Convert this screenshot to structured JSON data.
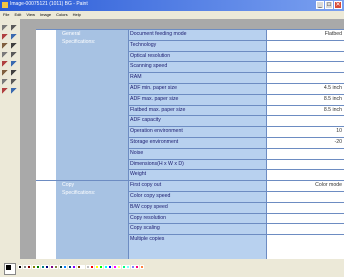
{
  "window": {
    "title": "Image-00075121 (1011) BG - Paint",
    "controls": [
      "_",
      "□",
      "✕"
    ]
  },
  "menubar": {
    "items": [
      "File",
      "Edit",
      "View",
      "Image",
      "Colors",
      "Help"
    ]
  },
  "toolbox": {
    "tools": [
      "free-select",
      "select",
      "eraser",
      "fill",
      "color-picker",
      "magnifier",
      "pencil",
      "brush",
      "airbrush",
      "text",
      "line",
      "curve",
      "rectangle",
      "polygon",
      "ellipse",
      "rounded-rectangle"
    ]
  },
  "document": {
    "sections": [
      {
        "label_lines": [
          "General",
          "Specifications:"
        ],
        "rows": [
          {
            "spec": "Document feeding mode",
            "value": "Flatbed"
          },
          {
            "spec": "Technology",
            "value": ""
          },
          {
            "spec": "Optical resolution",
            "value": ""
          },
          {
            "spec": "Scanning speed",
            "value": ""
          },
          {
            "spec": "RAM",
            "value": ""
          },
          {
            "spec": "ADF min. paper size",
            "value": "4.5 inch"
          },
          {
            "spec": "ADF max. paper size",
            "value": "8.5 inch"
          },
          {
            "spec": "Flatbed max. paper size",
            "value": "8.5 inch"
          },
          {
            "spec": "ADF capacity",
            "value": ""
          },
          {
            "spec": "Operation environment",
            "value": "10"
          },
          {
            "spec": "Storage environment",
            "value": "-20"
          },
          {
            "spec": "Noise",
            "value": ""
          },
          {
            "spec": "Dimensions(H x W x D)",
            "value": ""
          },
          {
            "spec": "Weight",
            "value": ""
          }
        ]
      },
      {
        "label_lines": [
          "Copy",
          "Specifications:"
        ],
        "rows": [
          {
            "spec": "First copy out",
            "value": "Color mode"
          },
          {
            "spec": "Color copy speed",
            "value": ""
          },
          {
            "spec": "B/W copy speed",
            "value": ""
          },
          {
            "spec": "Copy resolution",
            "value": ""
          },
          {
            "spec": "Copy scaling",
            "value": ""
          },
          {
            "spec": "Multiple copies",
            "value": ""
          }
        ]
      }
    ]
  },
  "palette": {
    "colors": [
      "#000000",
      "#808080",
      "#800000",
      "#808000",
      "#008000",
      "#008080",
      "#000080",
      "#800080",
      "#808040",
      "#004040",
      "#0080ff",
      "#004080",
      "#8000ff",
      "#804000",
      "#ffffff",
      "#c0c0c0",
      "#ff0000",
      "#ffff00",
      "#00ff00",
      "#00ffff",
      "#0000ff",
      "#ff00ff",
      "#ffff80",
      "#00ff80",
      "#80ffff",
      "#8080ff",
      "#ff0080",
      "#ff8040"
    ]
  }
}
